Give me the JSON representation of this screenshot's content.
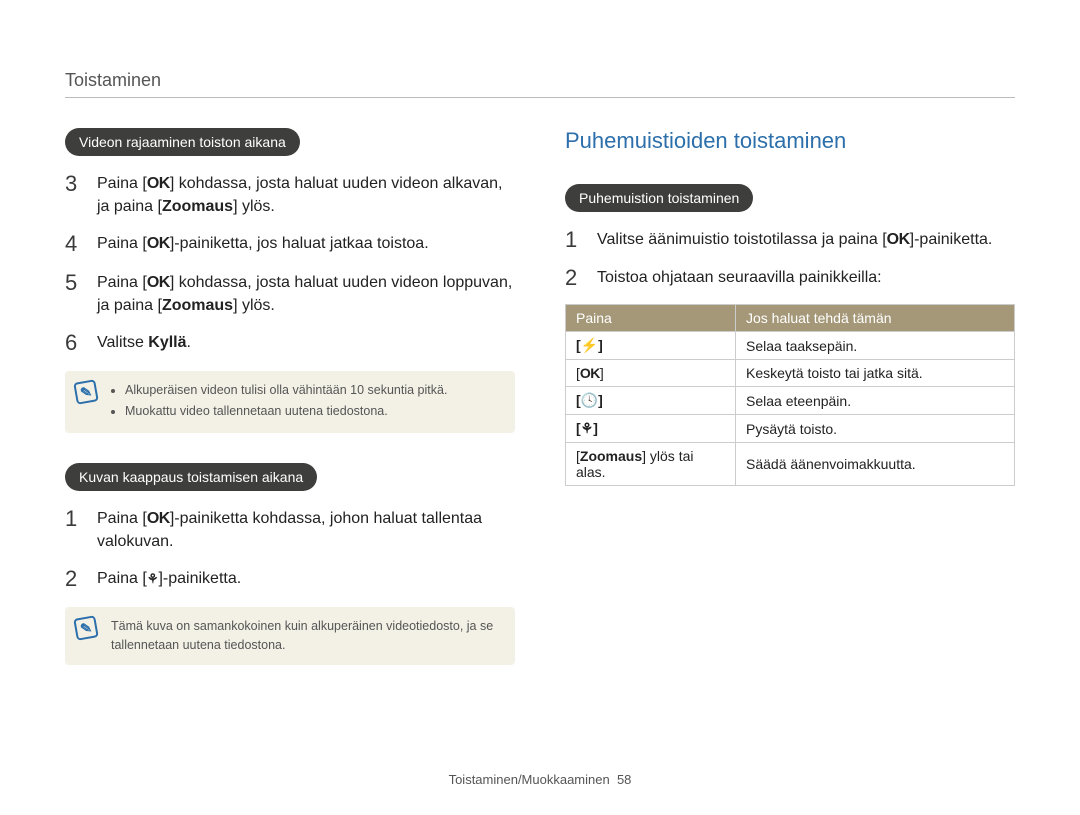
{
  "header": {
    "title": "Toistaminen"
  },
  "left": {
    "section1": {
      "pill": "Videon rajaaminen toiston aikana",
      "steps": [
        {
          "n": "3",
          "pre": "Paina [",
          "key": "OK",
          "post": "] kohdassa, josta haluat uuden videon alkavan, ja paina [",
          "bold": "Zoomaus",
          "tail": "] ylös."
        },
        {
          "n": "4",
          "pre": "Paina [",
          "key": "OK",
          "post": "]-painiketta, jos haluat jatkaa toistoa."
        },
        {
          "n": "5",
          "pre": "Paina [",
          "key": "OK",
          "post": "] kohdassa, josta haluat uuden videon loppuvan, ja paina [",
          "bold": "Zoomaus",
          "tail": "] ylös."
        },
        {
          "n": "6",
          "pre": "Valitse ",
          "bold": "Kyllä",
          "tail": "."
        }
      ],
      "note_items": [
        "Alkuperäisen videon tulisi olla vähintään 10 sekuntia pitkä.",
        "Muokattu video tallennetaan uutena tiedostona."
      ]
    },
    "section2": {
      "pill": "Kuvan kaappaus toistamisen aikana",
      "steps": [
        {
          "n": "1",
          "pre": "Paina [",
          "key": "OK",
          "post": "]-painiketta kohdassa, johon haluat tallentaa valokuvan."
        },
        {
          "n": "2",
          "pre": "Paina [",
          "icon": "macro",
          "post": "]-painiketta."
        }
      ],
      "note_text": "Tämä kuva on samankokoinen kuin alkuperäinen videotiedosto, ja se tallennetaan uutena tiedostona."
    }
  },
  "right": {
    "title": "Puhemuistioiden toistaminen",
    "pill": "Puhemuistion toistaminen",
    "steps": [
      {
        "n": "1",
        "pre": "Valitse äänimuistio toistotilassa ja paina [",
        "key": "OK",
        "post": "]-painiketta."
      },
      {
        "n": "2",
        "pre": "Toistoa ohjataan seuraavilla painikkeilla:"
      }
    ],
    "table": {
      "headers": [
        "Paina",
        "Jos haluat tehdä tämän"
      ],
      "rows": [
        {
          "key_html": "[⚡]",
          "action": "Selaa taaksepäin."
        },
        {
          "key_html": "[OK]",
          "key_bold": true,
          "action": "Keskeytä toisto tai jatka sitä."
        },
        {
          "key_html": "[🕓]",
          "action": "Selaa eteenpäin."
        },
        {
          "key_html": "[⚘]",
          "action": "Pysäytä toisto."
        },
        {
          "key_text_pre": "[",
          "key_bold_inner": "Zoomaus",
          "key_text_post": "] ylös tai alas.",
          "action": "Säädä äänenvoimakkuutta."
        }
      ]
    }
  },
  "footer": {
    "text": "Toistaminen/Muokkaaminen",
    "page": "58"
  }
}
